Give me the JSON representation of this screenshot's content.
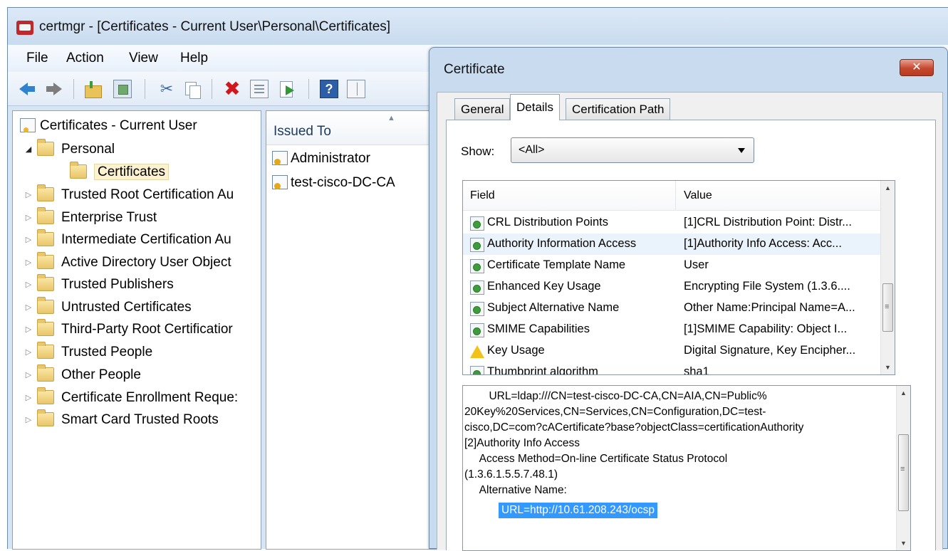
{
  "window": {
    "title": "certmgr - [Certificates - Current User\\Personal\\Certificates]"
  },
  "menu": [
    "File",
    "Action",
    "View",
    "Help"
  ],
  "toolbar": {
    "delete_glyph": "✖",
    "help_glyph": "?",
    "cut_glyph": "✂"
  },
  "tree": {
    "root": "Certificates - Current User",
    "personal": "Personal",
    "certificates": "Certificates",
    "items": [
      "Trusted Root Certification Au",
      "Enterprise Trust",
      "Intermediate Certification Au",
      "Active Directory User Object",
      "Trusted Publishers",
      "Untrusted Certificates",
      "Third-Party Root Certificatior",
      "Trusted People",
      "Other People",
      "Certificate Enrollment Reque:",
      "Smart Card Trusted Roots"
    ]
  },
  "list": {
    "header": "Issued To",
    "rows": [
      "Administrator",
      "test-cisco-DC-CA"
    ]
  },
  "dialog": {
    "title": "Certificate",
    "close_label": "✕",
    "tabs": [
      "General",
      "Details",
      "Certification Path"
    ],
    "active_tab": "Details",
    "show_label": "Show:",
    "show_value": "<All>",
    "columns": {
      "field": "Field",
      "value": "Value"
    },
    "fields": [
      {
        "field": "CRL Distribution Points",
        "value": "[1]CRL Distribution Point: Distr...",
        "icon": "extension-icon"
      },
      {
        "field": "Authority Information Access",
        "value": "[1]Authority Info Access: Acc...",
        "icon": "extension-icon",
        "selected": true
      },
      {
        "field": "Certificate Template Name",
        "value": "User",
        "icon": "extension-icon"
      },
      {
        "field": "Enhanced Key Usage",
        "value": "Encrypting File System (1.3.6....",
        "icon": "extension-icon"
      },
      {
        "field": "Subject Alternative Name",
        "value": "Other Name:Principal Name=A...",
        "icon": "extension-icon"
      },
      {
        "field": "SMIME Capabilities",
        "value": "[1]SMIME Capability: Object I...",
        "icon": "extension-icon"
      },
      {
        "field": "Key Usage",
        "value": "Digital Signature, Key Encipher...",
        "icon": "warning-icon"
      },
      {
        "field": "Thumbprint algorithm",
        "value": "sha1",
        "icon": "property-icon"
      }
    ],
    "detail_text": "        URL=ldap:///CN=test-cisco-DC-CA,CN=AIA,CN=Public%\n20Key%20Services,CN=Services,CN=Configuration,DC=test-\ncisco,DC=com?cACertificate?base?objectClass=certificationAuthority\n[2]Authority Info Access\n     Access Method=On-line Certificate Status Protocol\n(1.3.6.1.5.5.7.48.1)\n     Alternative Name:",
    "detail_highlight": "URL=http://10.61.208.243/ocsp"
  }
}
